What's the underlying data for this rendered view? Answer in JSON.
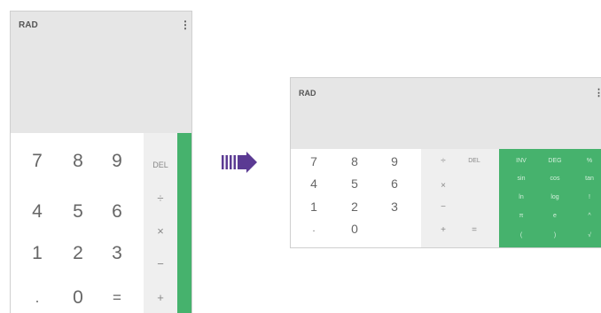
{
  "portrait": {
    "mode": "RAD",
    "menu": "⋮",
    "numpad": [
      "7",
      "8",
      "9",
      "4",
      "5",
      "6",
      "1",
      "2",
      "3",
      ".",
      "0",
      "="
    ],
    "ops": [
      "DEL",
      "÷",
      "×",
      "−",
      "+"
    ]
  },
  "arrow": {
    "color": "#5b3a93"
  },
  "landscape": {
    "mode": "RAD",
    "menu": "⋮",
    "numpad": [
      "7",
      "8",
      "9",
      "4",
      "5",
      "6",
      "1",
      "2",
      "3",
      ".",
      "0"
    ],
    "ops": [
      "÷",
      "DEL",
      "×",
      "−",
      "+",
      "="
    ],
    "advanced": [
      "INV",
      "DEG",
      "%",
      "sin",
      "cos",
      "tan",
      "ln",
      "log",
      "!",
      "π",
      "e",
      "^",
      "(",
      ")",
      "√"
    ]
  },
  "colors": {
    "display_bg": "#e6e6e6",
    "ops_bg": "#efefef",
    "advanced_bg": "#46b26d"
  }
}
